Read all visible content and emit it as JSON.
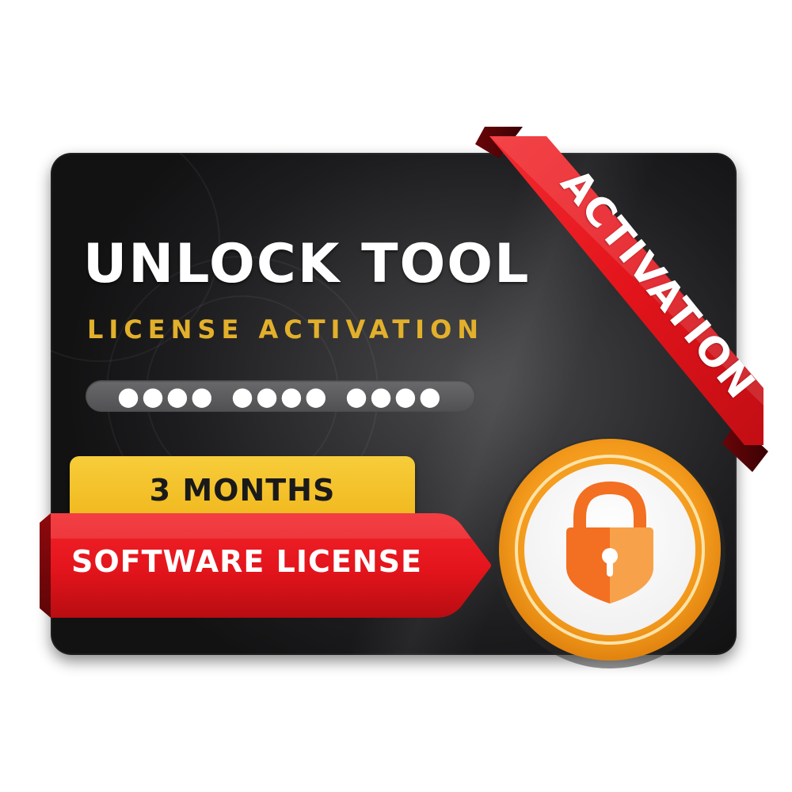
{
  "product": {
    "title": "UNLOCK TOOL",
    "subtitle": "LICENSE ACTIVATION"
  },
  "license_key": {
    "groups": [
      "●●●●",
      "●●●●",
      "●●●●"
    ]
  },
  "duration": {
    "label": "3 MONTHS"
  },
  "license_type": {
    "label": "SOFTWARE LICENSE"
  },
  "ribbon": {
    "label": "ACTIVATION"
  },
  "icons": {
    "medallion": "padlock-icon"
  },
  "colors": {
    "card_dark": "#1d1d1f",
    "title_white": "#ffffff",
    "subtitle_gold": "#e3b02b",
    "badge_yellow": "#f0b61c",
    "banner_red": "#e3141b",
    "ribbon_red": "#e3141b",
    "medallion_orange": "#f39a1c",
    "lock_orange": "#f36f21",
    "lock_light": "#f7a24a"
  }
}
